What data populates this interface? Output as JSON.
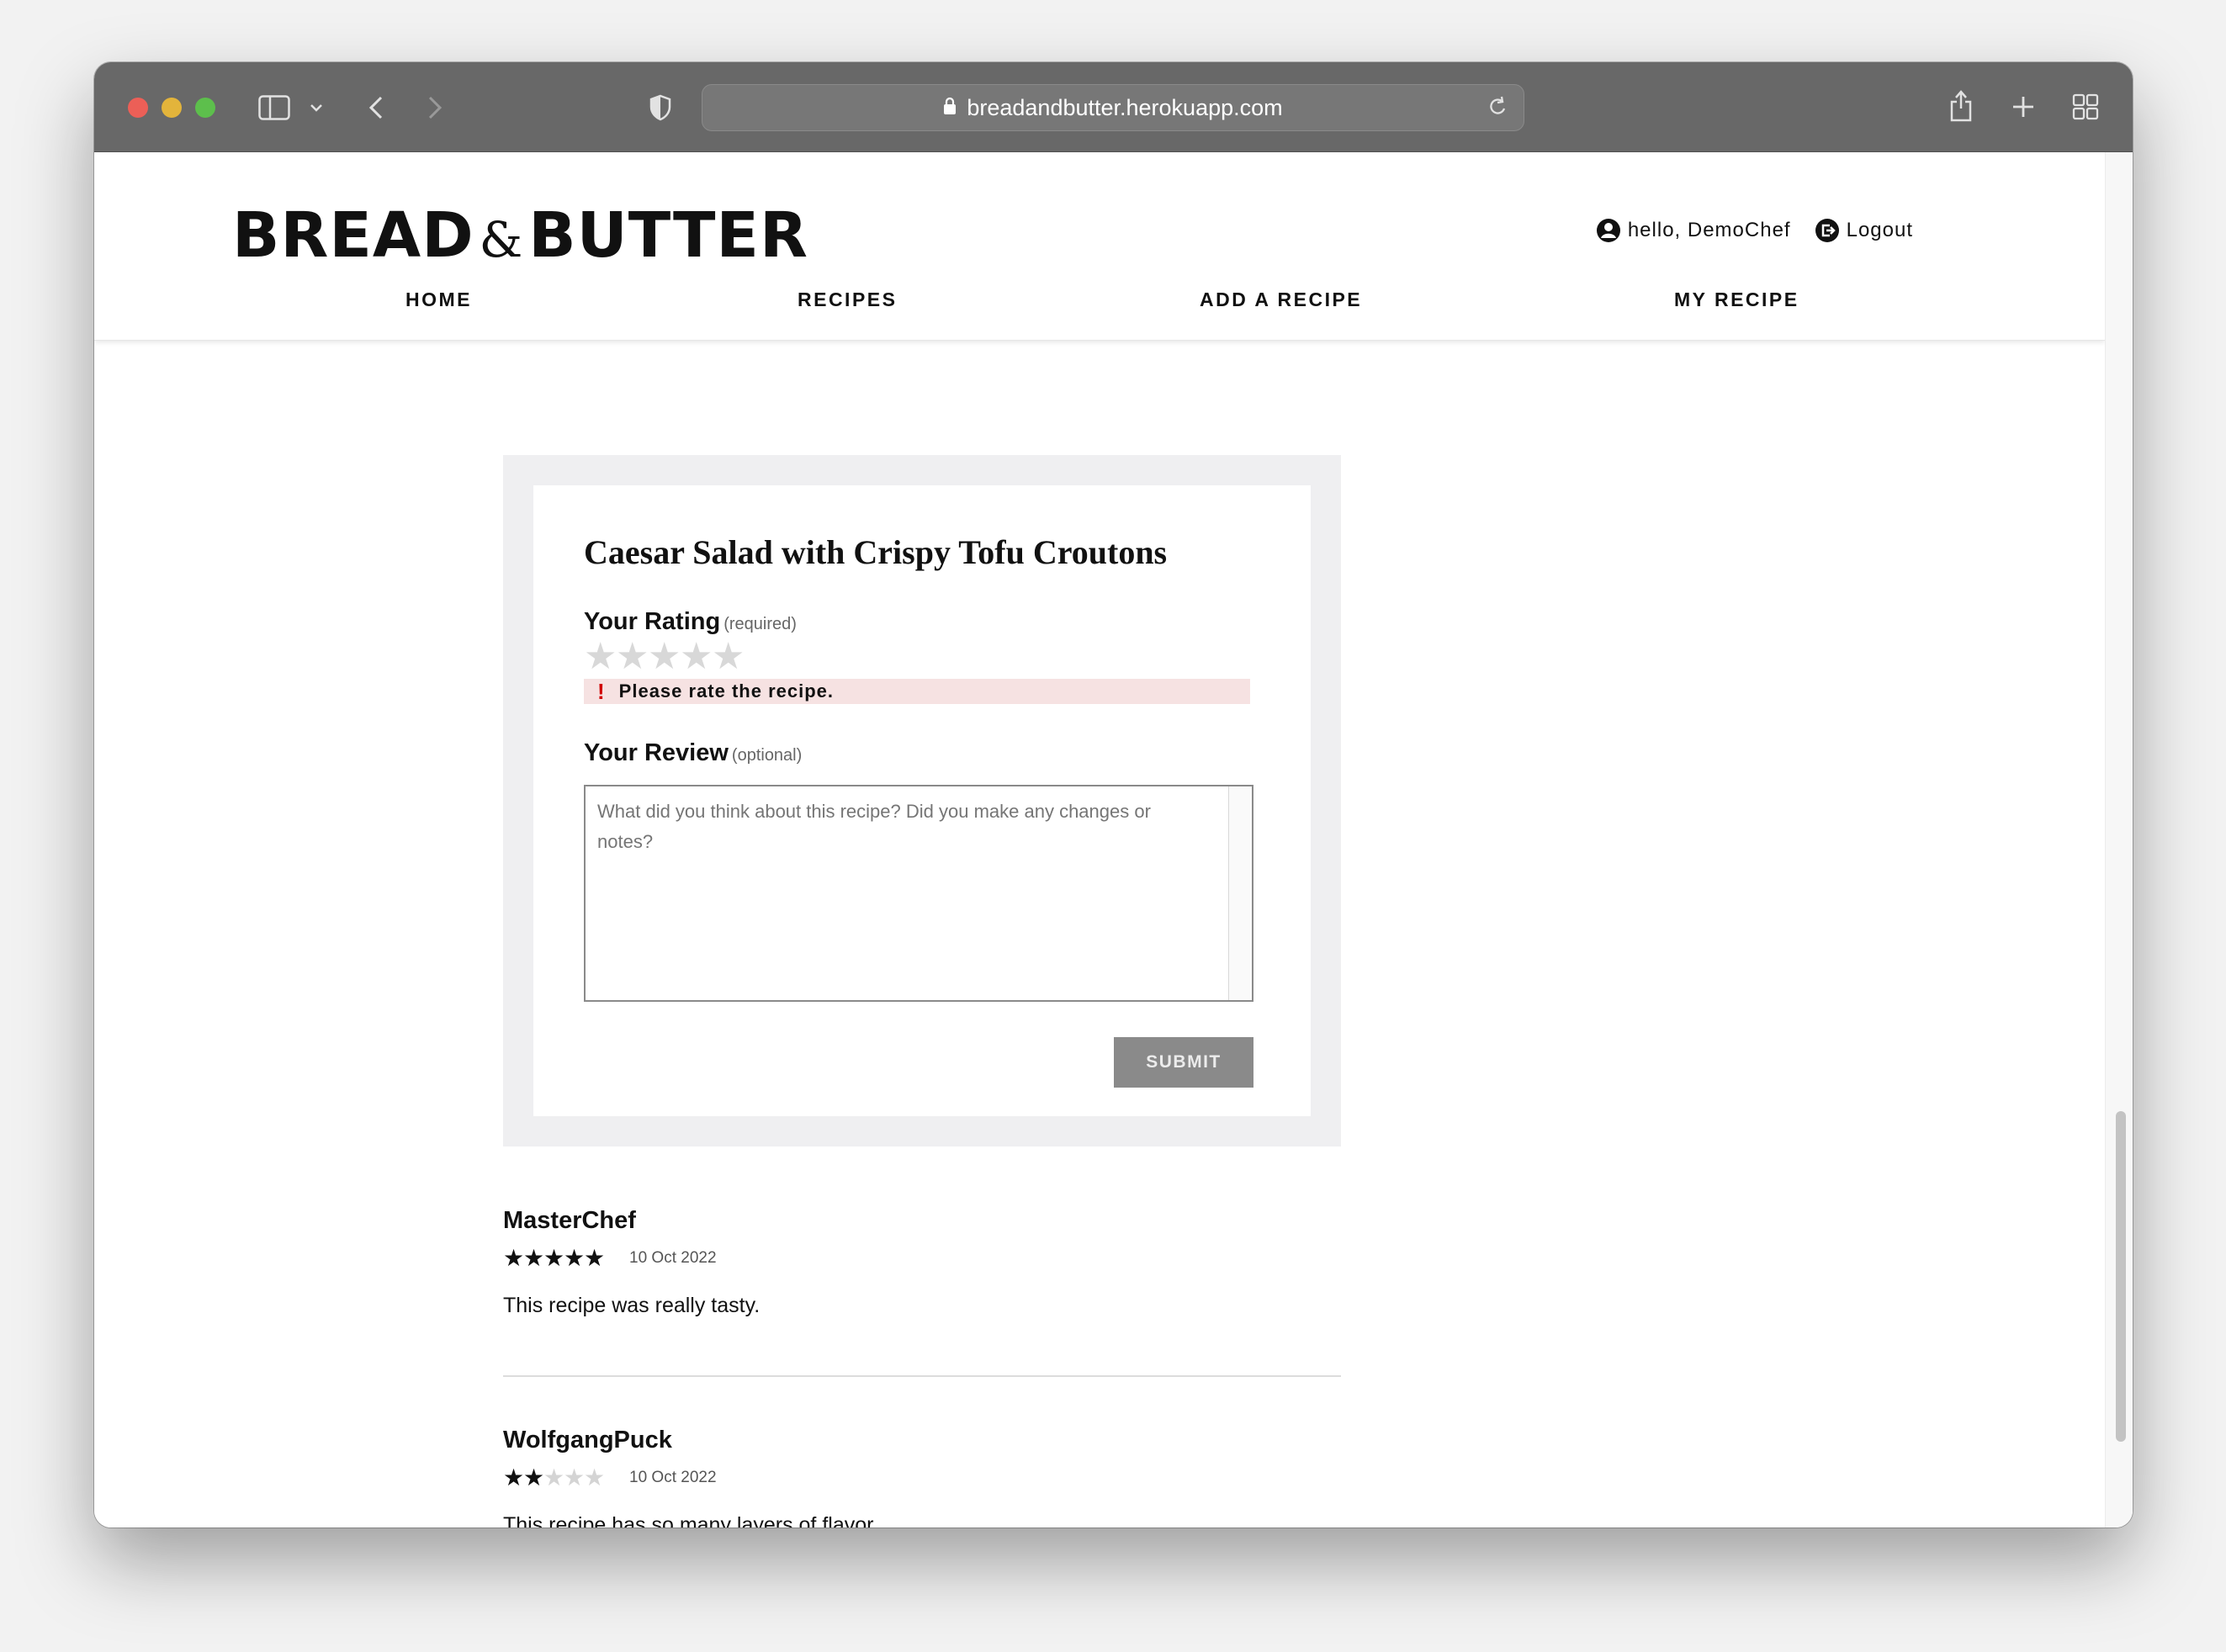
{
  "browser": {
    "url": "breadandbutter.herokuapp.com"
  },
  "site": {
    "logo_left": "BREAD",
    "logo_amp": "&",
    "logo_right": "BUTTER",
    "greeting": "hello, DemoChef",
    "logout": "Logout",
    "nav": [
      "HOME",
      "RECIPES",
      "ADD A RECIPE",
      "MY RECIPE"
    ]
  },
  "review_form": {
    "recipe_title": "Caesar Salad with Crispy Tofu Croutons",
    "rating_label": "Your Rating",
    "rating_hint": "(required)",
    "rating_value": 0,
    "rating_max": 5,
    "error": "Please rate the recipe.",
    "review_label": "Your Review",
    "review_hint": "(optional)",
    "review_placeholder": "What did you think about this recipe? Did you make any changes or notes?",
    "review_value": "",
    "submit": "SUBMIT"
  },
  "reviews": [
    {
      "author": "MasterChef",
      "rating": 5,
      "date": "10 Oct 2022",
      "text": "This recipe was really tasty."
    },
    {
      "author": "WolfgangPuck",
      "rating": 2,
      "date": "10 Oct 2022",
      "text": "This recipe has so many layers of flavor."
    }
  ]
}
